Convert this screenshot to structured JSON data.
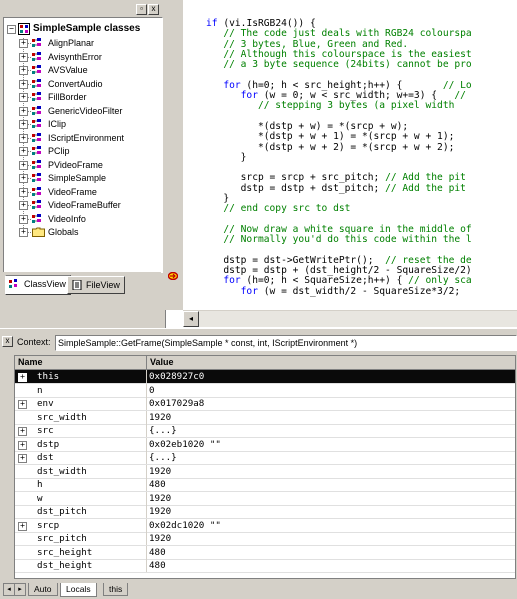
{
  "tree": {
    "root_label": "SimpleSample classes",
    "items": [
      {
        "label": "AlignPlanar"
      },
      {
        "label": "AvisynthError"
      },
      {
        "label": "AVSValue"
      },
      {
        "label": "ConvertAudio"
      },
      {
        "label": "FillBorder"
      },
      {
        "label": "GenericVideoFilter"
      },
      {
        "label": "IClip"
      },
      {
        "label": "IScriptEnvironment"
      },
      {
        "label": "PClip"
      },
      {
        "label": "PVideoFrame"
      },
      {
        "label": "SimpleSample"
      },
      {
        "label": "VideoFrame"
      },
      {
        "label": "VideoFrameBuffer"
      },
      {
        "label": "VideoInfo"
      },
      {
        "label": "Globals"
      }
    ],
    "tabs": [
      {
        "label": "ClassView"
      },
      {
        "label": "FileView"
      }
    ]
  },
  "titlebar": {
    "pin_label": "▫",
    "close_label": "x"
  },
  "editor": {
    "lines": [
      {
        "type": "code",
        "text": "if (vi.IsRGB24()) {"
      },
      {
        "type": "comment",
        "text": "   // The code just deals with RGB24 colourspa"
      },
      {
        "type": "comment",
        "text": "   // 3 bytes, Blue, Green and Red."
      },
      {
        "type": "comment",
        "text": "   // Although this colourspace is the easiest"
      },
      {
        "type": "comment",
        "text": "   // a 3 byte sequence (24bits) cannot be pro"
      },
      {
        "type": "blank",
        "text": ""
      },
      {
        "type": "mixed",
        "code": "   for (h=0; h < src_height;h++) {       ",
        "comment": "// Lo"
      },
      {
        "type": "mixed",
        "code": "      for (w = 0; w < src_width; w+=3) {   ",
        "comment": "//"
      },
      {
        "type": "comment",
        "text": "         // stepping 3 bytes (a pixel width"
      },
      {
        "type": "blank",
        "text": ""
      },
      {
        "type": "code",
        "text": "         *(dstp + w) = *(srcp + w);"
      },
      {
        "type": "code",
        "text": "         *(dstp + w + 1) = *(srcp + w + 1);"
      },
      {
        "type": "code",
        "text": "         *(dstp + w + 2) = *(srcp + w + 2);"
      },
      {
        "type": "code",
        "text": "      }"
      },
      {
        "type": "blank",
        "text": ""
      },
      {
        "type": "mixed",
        "code": "      srcp = srcp + src_pitch; ",
        "comment": "// Add the pit"
      },
      {
        "type": "mixed",
        "code": "      dstp = dstp + dst_pitch; ",
        "comment": "// Add the pit"
      },
      {
        "type": "code",
        "text": "   }"
      },
      {
        "type": "comment",
        "text": "   // end copy src to dst"
      },
      {
        "type": "blank",
        "text": ""
      },
      {
        "type": "comment",
        "text": "   // Now draw a white square in the middle of"
      },
      {
        "type": "comment",
        "text": "   // Normally you'd do this code within the l"
      },
      {
        "type": "blank",
        "text": ""
      },
      {
        "type": "mixed",
        "code": "   dstp = dst->GetWritePtr();  ",
        "comment": "// reset the de"
      },
      {
        "type": "code",
        "text": "   dstp = dstp + (dst_height/2 - SquareSize/2)"
      },
      {
        "type": "mixed",
        "code": "   for (h=0; h < SquareSize;h++) { ",
        "comment": "// only sca"
      },
      {
        "type": "code",
        "text": "      for (w = dst_width/2 - SquareSize*3/2;"
      }
    ]
  },
  "watch": {
    "context_label": "Context:",
    "context_value": "SimpleSample::GetFrame(SimpleSample * const, int, IScriptEnvironment *)",
    "col_name": "Name",
    "col_value": "Value",
    "rows": [
      {
        "name": "this",
        "value": "0x028927c0",
        "expandable": true,
        "selected": true
      },
      {
        "name": "n",
        "value": "0",
        "expandable": false
      },
      {
        "name": "env",
        "value": "0x017029a8",
        "expandable": true
      },
      {
        "name": "src_width",
        "value": "1920",
        "expandable": false
      },
      {
        "name": "src",
        "value": "{...}",
        "expandable": true
      },
      {
        "name": "dstp",
        "value": "0x02eb1020 \"\"",
        "expandable": true
      },
      {
        "name": "dst",
        "value": "{...}",
        "expandable": true
      },
      {
        "name": "dst_width",
        "value": "1920",
        "expandable": false
      },
      {
        "name": "h",
        "value": "480",
        "expandable": false
      },
      {
        "name": "w",
        "value": "1920",
        "expandable": false
      },
      {
        "name": "dst_pitch",
        "value": "1920",
        "expandable": false
      },
      {
        "name": "srcp",
        "value": "0x02dc1020 \"\"",
        "expandable": true
      },
      {
        "name": "src_pitch",
        "value": "1920",
        "expandable": false
      },
      {
        "name": "src_height",
        "value": "480",
        "expandable": false
      },
      {
        "name": "dst_height",
        "value": "480",
        "expandable": false
      }
    ],
    "tabs": [
      {
        "label": "Auto"
      },
      {
        "label": "Locals"
      },
      {
        "label": "this"
      }
    ]
  },
  "colors": {
    "keyword": "#0000ff",
    "comment": "#008000",
    "selection": "#0a0a0a"
  }
}
